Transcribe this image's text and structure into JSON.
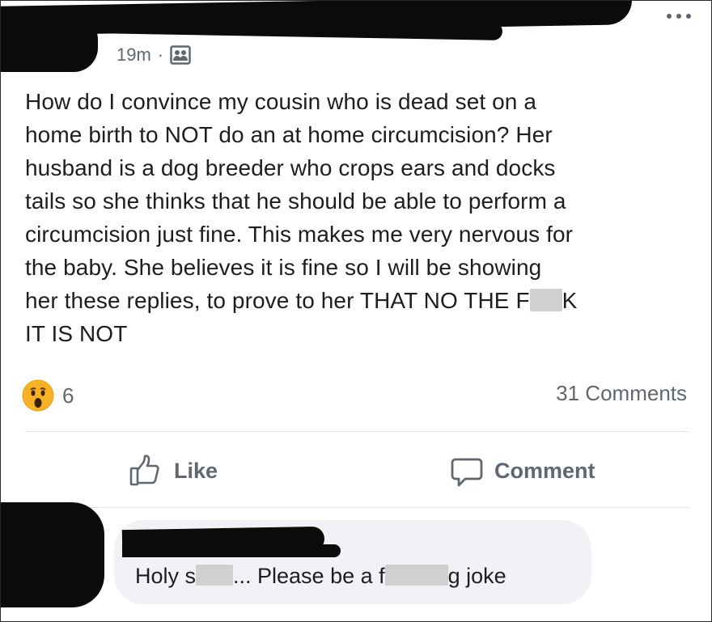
{
  "post": {
    "timestamp": "19m",
    "separator": "·",
    "audience_icon": "group-icon",
    "text_part1": "How do I convince my cousin who is dead set on a\nhome birth to NOT do an at home circumcision? Her\nhusband is a dog breeder who crops ears and docks\ntails so she thinks that he should be able to perform a\ncircumcision just fine. This makes me very nervous for\nthe baby. She believes it is fine so I will be showing\nher these replies, to prove to her THAT NO THE F",
    "text_part2": "K\nIT IS NOT",
    "reaction_icon": "wow-reaction-icon",
    "reaction_count": "6",
    "comments_count": "31 Comments"
  },
  "actions": {
    "like_label": "Like",
    "comment_label": "Comment"
  },
  "comment": {
    "text_part1": "Holy s",
    "text_part2": "... Please be a f",
    "text_part3": "g joke"
  },
  "colors": {
    "text": "#1c1e21",
    "secondary": "#606770",
    "bubble": "#f0f2f5",
    "divider": "#dddfe2",
    "wow_face": "#f7b125"
  }
}
